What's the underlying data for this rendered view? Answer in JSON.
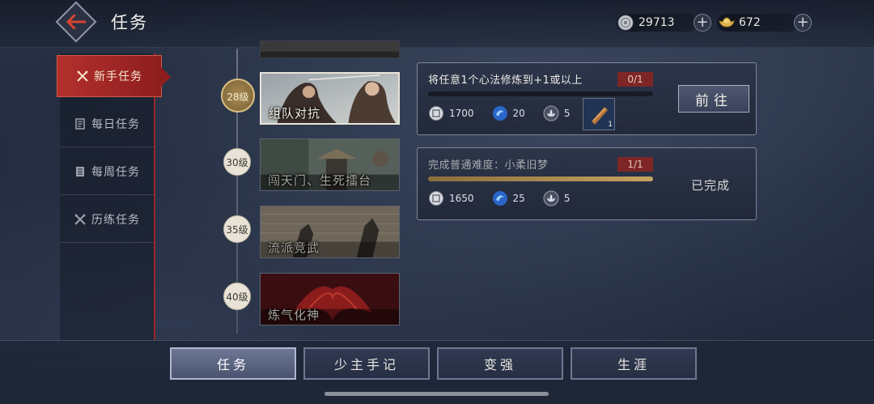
{
  "header": {
    "title": "任务",
    "currency": [
      {
        "icon": "silver-coin-icon",
        "value": "29713"
      },
      {
        "icon": "gold-ingot-icon",
        "value": "672"
      }
    ]
  },
  "sidebar": {
    "items": [
      {
        "label": "新手任务",
        "icon": "crossed-swords-icon",
        "active": true
      },
      {
        "label": "每日任务",
        "icon": "scroll-icon",
        "active": false
      },
      {
        "label": "每周任务",
        "icon": "book-icon",
        "active": false
      },
      {
        "label": "历练任务",
        "icon": "crossed-swords-icon",
        "active": false
      }
    ]
  },
  "stages": [
    {
      "level": "28级",
      "name": "组队对抗",
      "active": true
    },
    {
      "level": "30级",
      "name": "闯天门、生死擂台",
      "active": false
    },
    {
      "level": "35级",
      "name": "流派竞武",
      "active": false
    },
    {
      "level": "40级",
      "name": "炼气化神",
      "active": false
    }
  ],
  "tasks": [
    {
      "title": "将任意1个心法修炼到+1或以上",
      "progress": "0/1",
      "progress_fraction": 0,
      "rewards": [
        {
          "icon": "coin-icon",
          "value": "1700"
        },
        {
          "icon": "spirit-orb-icon",
          "value": "20"
        },
        {
          "icon": "lotus-icon",
          "value": "5"
        }
      ],
      "item": {
        "icon": "scroll-item-icon",
        "count": "1"
      },
      "action": "前往"
    },
    {
      "title": "完成普通难度：小柔旧梦",
      "progress": "1/1",
      "progress_fraction": 1,
      "rewards": [
        {
          "icon": "coin-icon",
          "value": "1650"
        },
        {
          "icon": "spirit-orb-icon",
          "value": "25"
        },
        {
          "icon": "lotus-icon",
          "value": "5"
        }
      ],
      "status": "已完成"
    }
  ],
  "bottom_tabs": [
    {
      "label": "任务",
      "active": true
    },
    {
      "label": "少主手记",
      "active": false
    },
    {
      "label": "变强",
      "active": false
    },
    {
      "label": "生涯",
      "active": false
    }
  ],
  "colors": {
    "accent_red": "#9b2628",
    "gold": "#c6a462",
    "panel": "#2c3448"
  }
}
